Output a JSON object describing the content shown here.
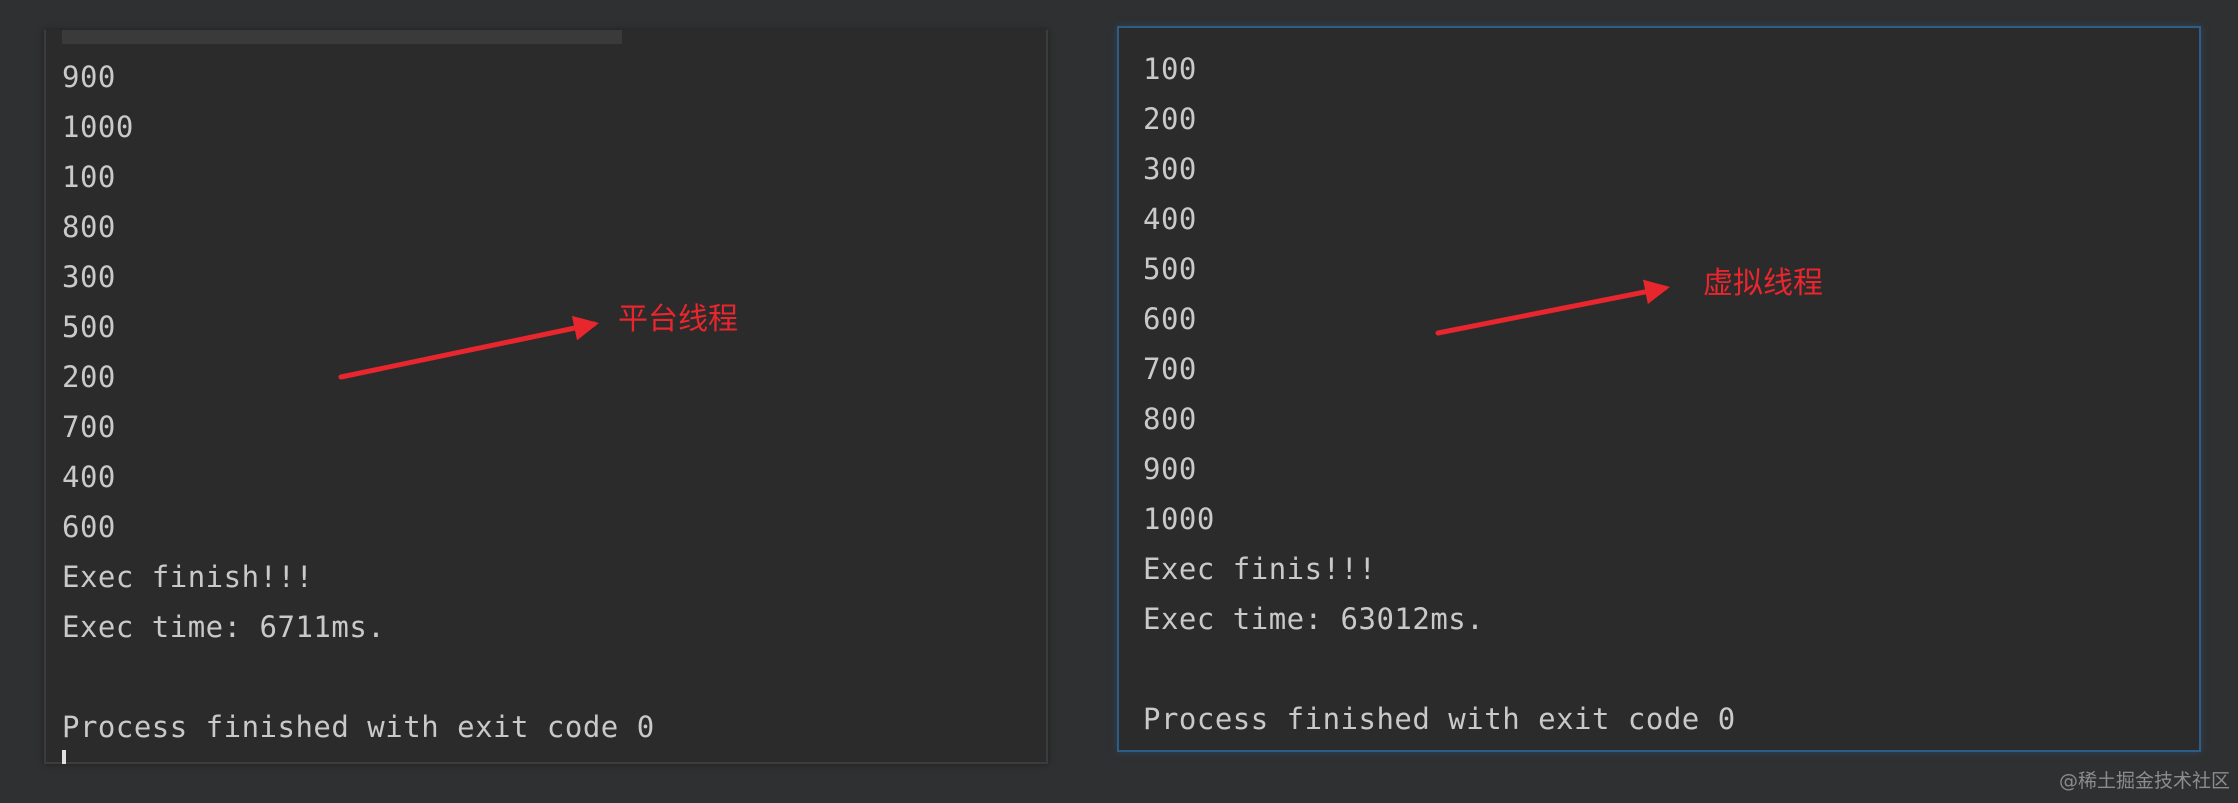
{
  "left_panel": {
    "clipped_header": "",
    "lines": [
      "900",
      "1000",
      "100",
      "800",
      "300",
      "500",
      "200",
      "700",
      "400",
      "600",
      "Exec finish!!!",
      "Exec time: 6711ms.",
      "",
      "Process finished with exit code 0"
    ]
  },
  "right_panel": {
    "lines": [
      "100",
      "200",
      "300",
      "400",
      "500",
      "600",
      "700",
      "800",
      "900",
      "1000",
      "Exec finis!!!",
      "Exec time: 63012ms.",
      "",
      "Process finished with exit code 0"
    ]
  },
  "annotations": {
    "left_label": "平台线程",
    "right_label": "虚拟线程",
    "color": "#e8262e"
  },
  "watermark": "@稀土掘金技术社区",
  "colors": {
    "background": "#2f3031",
    "panel": "#2b2b2b",
    "text": "#c9c9c9",
    "active_border": "#2e5d8a"
  }
}
